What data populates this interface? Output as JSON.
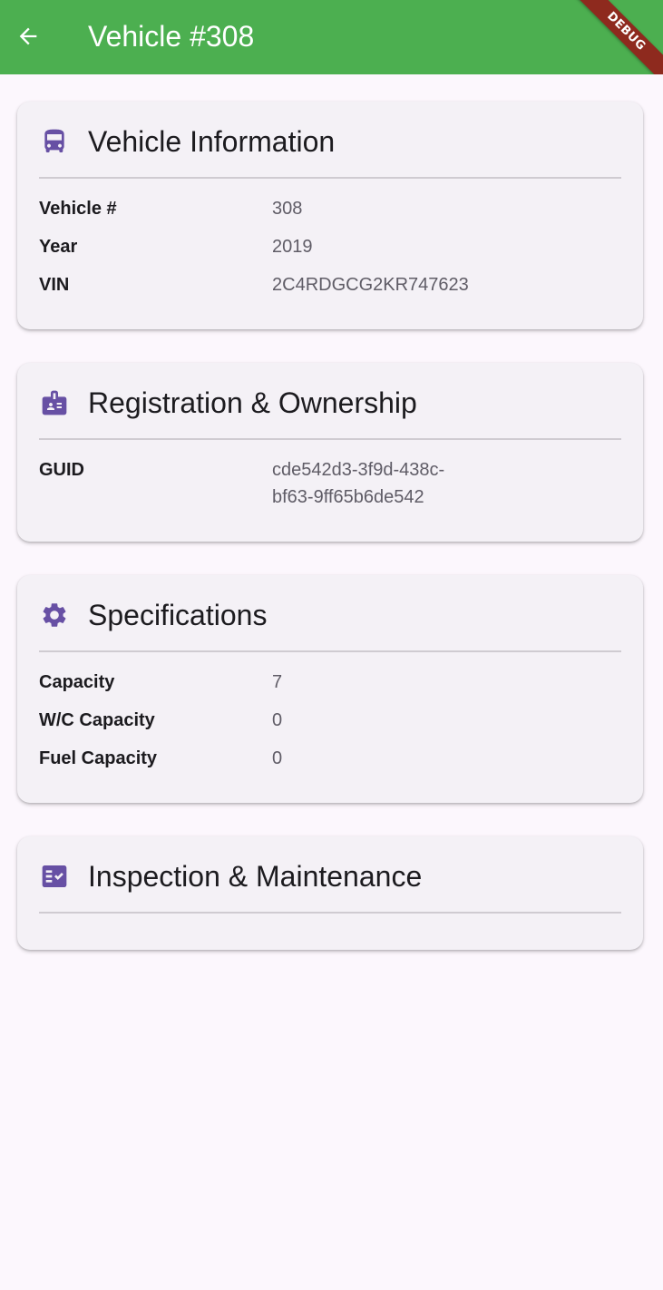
{
  "app_bar": {
    "title": "Vehicle #308",
    "background_color": "#4CAF50",
    "back_icon": "arrow-left-icon",
    "debug_label": "DEBUG"
  },
  "accent_color": "#6750A4",
  "sections": {
    "vehicle_info": {
      "title": "Vehicle Information",
      "icon": "bus-icon",
      "rows": [
        {
          "label": "Vehicle #",
          "value": "308"
        },
        {
          "label": "Year",
          "value": "2019"
        },
        {
          "label": "VIN",
          "value": "2C4RDGCG2KR747623"
        }
      ]
    },
    "registration": {
      "title": "Registration & Ownership",
      "icon": "id-badge-icon",
      "rows": [
        {
          "label": "GUID",
          "value_line1": "cde542d3-3f9d-438c-",
          "value_line2": "bf63-9ff65b6de542"
        }
      ]
    },
    "specifications": {
      "title": "Specifications",
      "icon": "gear-icon",
      "rows": [
        {
          "label": "Capacity",
          "value": "7"
        },
        {
          "label": "W/C Capacity",
          "value": "0"
        },
        {
          "label": "Fuel Capacity",
          "value": "0"
        }
      ]
    },
    "inspection": {
      "title": "Inspection & Maintenance",
      "icon": "checklist-icon",
      "rows": []
    }
  }
}
